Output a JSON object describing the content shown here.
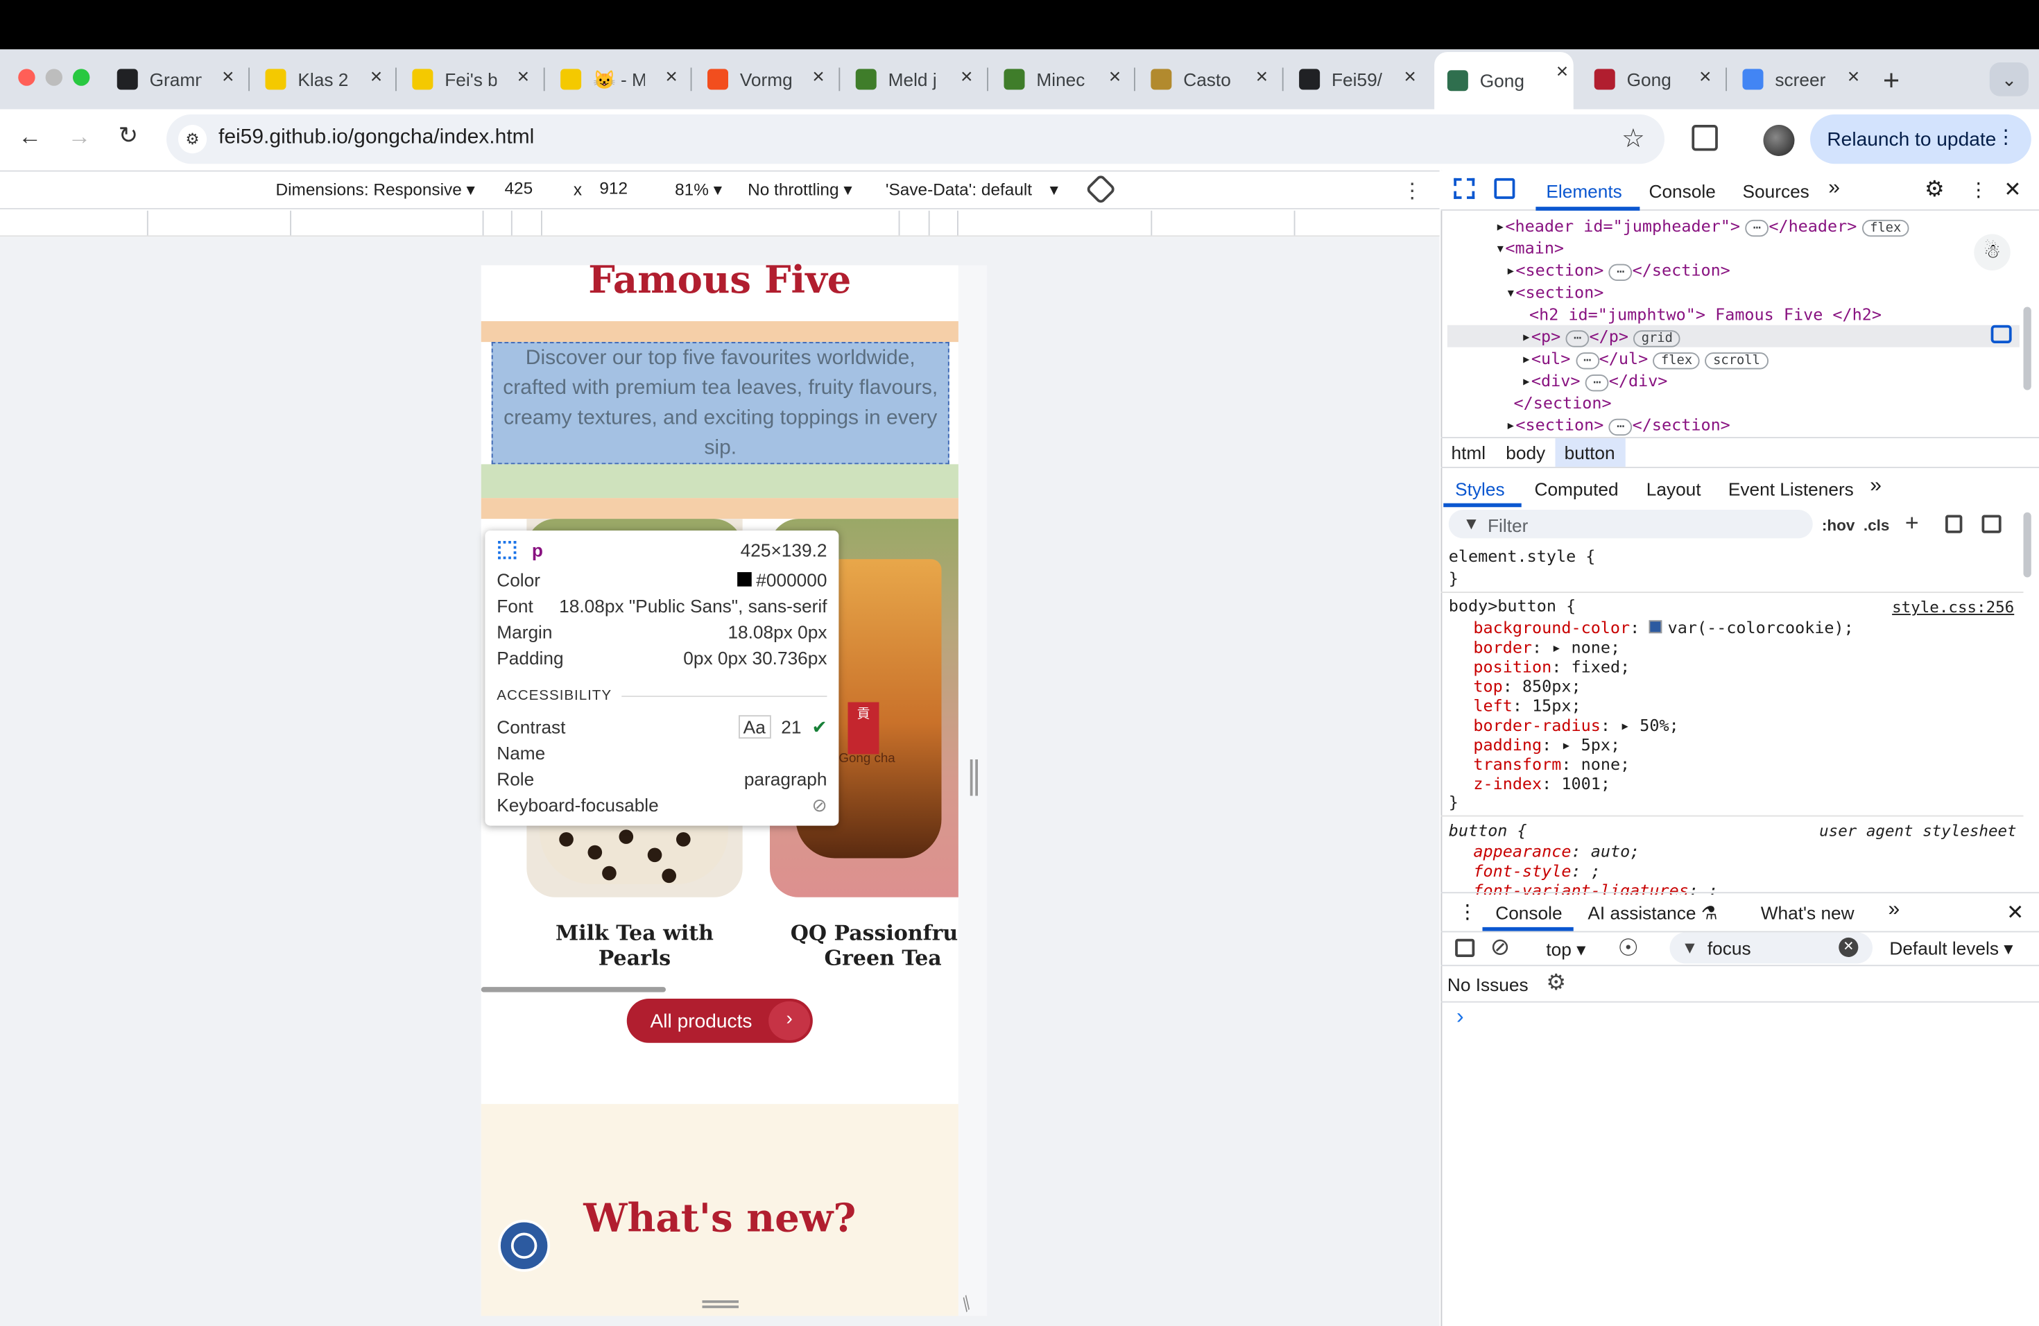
{
  "browser": {
    "tabs": [
      {
        "title": "Gramm",
        "icon": "openai-icon",
        "color": "#202124"
      },
      {
        "title": "Klas 2",
        "icon": "miro-icon",
        "color": "#f4c900"
      },
      {
        "title": "Fei's b",
        "icon": "miro-icon",
        "color": "#f4c900"
      },
      {
        "title": "😺 - M",
        "icon": "miro-icon",
        "color": "#f4c900"
      },
      {
        "title": "Vormg",
        "icon": "figma-icon",
        "color": "#f24e1e"
      },
      {
        "title": "Meld j",
        "icon": "minecraft-icon",
        "color": "#3f7d2a"
      },
      {
        "title": "Minec",
        "icon": "minecraft-icon",
        "color": "#3f7d2a"
      },
      {
        "title": "Casto",
        "icon": "castopod-icon",
        "color": "#b28a2e"
      },
      {
        "title": "Fei59/",
        "icon": "github-icon",
        "color": "#202124"
      },
      {
        "title": "Gong",
        "icon": "gongcha-icon",
        "color": "#2f6f4e",
        "active": true
      },
      {
        "title": "Gong",
        "icon": "gongcha-icon",
        "color": "#b11e2f"
      },
      {
        "title": "screer",
        "icon": "google-icon",
        "color": "#4285f4"
      }
    ],
    "url": "fei59.github.io/gongcha/index.html",
    "relaunch": "Relaunch to update"
  },
  "device_toolbar": {
    "dimensions": "Dimensions: Responsive",
    "width": "425",
    "times": "x",
    "height": "912",
    "zoom": "81%",
    "throttling": "No throttling",
    "save_data": "'Save-Data': default"
  },
  "page": {
    "section_title": "Famous Five",
    "intro": "Discover our top five favourites worldwide, crafted with premium tea leaves, fruity flavours, creamy textures, and exciting toppings in every sip.",
    "products": [
      "Milk Tea with Pearls",
      "QQ Passionfruit Green Tea"
    ],
    "all_products": "All products",
    "whats_new": "What's new?",
    "cup_label": "Gong cha"
  },
  "tooltip": {
    "tag": "p",
    "size": "425×139.2",
    "rows": [
      {
        "label": "Color",
        "value": "#000000"
      },
      {
        "label": "Font",
        "value": "18.08px \"Public Sans\", sans-serif"
      },
      {
        "label": "Margin",
        "value": "18.08px 0px"
      },
      {
        "label": "Padding",
        "value": "0px 0px 30.736px"
      }
    ],
    "accessibility": "ACCESSIBILITY",
    "contrast_label": "Contrast",
    "contrast_aa": "Aa",
    "contrast_value": "21",
    "name_label": "Name",
    "role_label": "Role",
    "role_value": "paragraph",
    "focus_label": "Keyboard-focusable"
  },
  "devtools": {
    "tabs": [
      "Elements",
      "Console",
      "Sources"
    ],
    "dom": {
      "header_open": "<header id=\"jumpheader\">",
      "header_close": "</header>",
      "main_open": "<main>",
      "section_collapsed": "<section>",
      "section_close": "</section>",
      "section_open": "<section>",
      "h2": "<h2 id=\"jumphtwo\"> Famous Five </h2>",
      "p_open": "<p>",
      "p_close": "</p>",
      "ul_open": "<ul>",
      "ul_close": "</ul>",
      "div_open": "<div>",
      "div_close": "</div>",
      "ellipsis": "⋯",
      "badge_flex": "flex",
      "badge_grid": "grid",
      "badge_scroll": "scroll"
    },
    "breadcrumbs": [
      "html",
      "body",
      "button"
    ],
    "panel_tabs": [
      "Styles",
      "Computed",
      "Layout",
      "Event Listeners"
    ],
    "filter_placeholder": "Filter",
    "hov": ":hov",
    "cls": ".cls",
    "rules": {
      "element_style": "element.style {",
      "close": "}",
      "body_button": "body>button {",
      "source": "style.css:256",
      "decls": [
        [
          "background-color",
          "var(--colorcookie);"
        ],
        [
          "border",
          "▸ none;"
        ],
        [
          "position",
          "fixed;"
        ],
        [
          "top",
          "850px;"
        ],
        [
          "left",
          "15px;"
        ],
        [
          "border-radius",
          "▸ 50%;"
        ],
        [
          "padding",
          "▸ 5px;"
        ],
        [
          "transform",
          "none;"
        ],
        [
          "z-index",
          "1001;"
        ]
      ],
      "ua_selector": "button {",
      "ua_source": "user agent stylesheet",
      "ua_decls": [
        [
          "appearance",
          "auto;"
        ],
        [
          "font-style",
          ";"
        ],
        [
          "font-variant-ligatures",
          ";"
        ]
      ]
    },
    "drawer_tabs": [
      "Console",
      "AI assistance",
      "What's new"
    ],
    "context": "top",
    "console_filter": "focus",
    "levels": "Default levels",
    "no_issues": "No Issues",
    "prompt": "›"
  },
  "colors": {
    "brand": "#b11e2f",
    "devtools_accent": "#0b57d0",
    "highlight": "#a4c1e3",
    "swatch": "#2c5aa0"
  }
}
